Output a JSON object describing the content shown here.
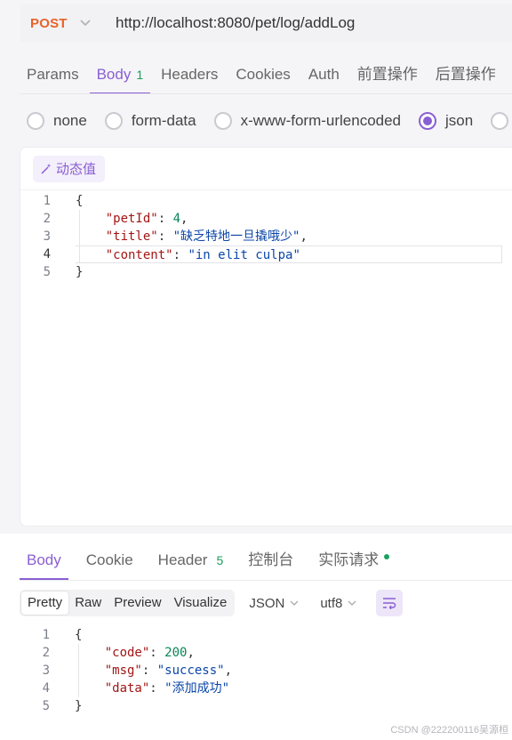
{
  "request": {
    "method": "POST",
    "url": "http://localhost:8080/pet/log/addLog",
    "method_color": "#e8622a"
  },
  "request_tabs": [
    {
      "label": "Params"
    },
    {
      "label": "Body",
      "count": "1"
    },
    {
      "label": "Headers"
    },
    {
      "label": "Cookies"
    },
    {
      "label": "Auth"
    },
    {
      "label": "前置操作"
    },
    {
      "label": "后置操作"
    }
  ],
  "body_types": [
    {
      "label": "none",
      "checked": false
    },
    {
      "label": "form-data",
      "checked": false
    },
    {
      "label": "x-www-form-urlencoded",
      "checked": false
    },
    {
      "label": "json",
      "checked": true
    }
  ],
  "editor": {
    "dynamic_value_label": "动态值",
    "line_numbers": [
      "1",
      "2",
      "3",
      "4",
      "5"
    ],
    "lines": {
      "l1": "{",
      "petId_key": "\"petId\"",
      "petId_val": "4",
      "title_key": "\"title\"",
      "title_val": "\"缺乏特地一旦撬哦少\"",
      "content_key": "\"content\"",
      "content_val": "\"in elit culpa\"",
      "l5": "}"
    }
  },
  "response_tabs": [
    {
      "label": "Body"
    },
    {
      "label": "Cookie"
    },
    {
      "label": "Header",
      "count": "5"
    },
    {
      "label": "控制台"
    },
    {
      "label": "实际请求"
    }
  ],
  "view_modes": [
    "Pretty",
    "Raw",
    "Preview",
    "Visualize"
  ],
  "format_select": "JSON",
  "encoding_select": "utf8",
  "response": {
    "line_numbers": [
      "1",
      "2",
      "3",
      "4",
      "5"
    ],
    "lines": {
      "l1": "{",
      "code_key": "\"code\"",
      "code_val": "200",
      "msg_key": "\"msg\"",
      "msg_val": "\"success\"",
      "data_key": "\"data\"",
      "data_val": "\"添加成功\"",
      "l5": "}"
    }
  },
  "watermark": "CSDN @222200116吴源桓",
  "accent_color": "#8a5fd3",
  "icons": [
    "chevron-down-icon",
    "magic-wand-icon",
    "wrap-lines-icon",
    "status-dot-icon"
  ]
}
